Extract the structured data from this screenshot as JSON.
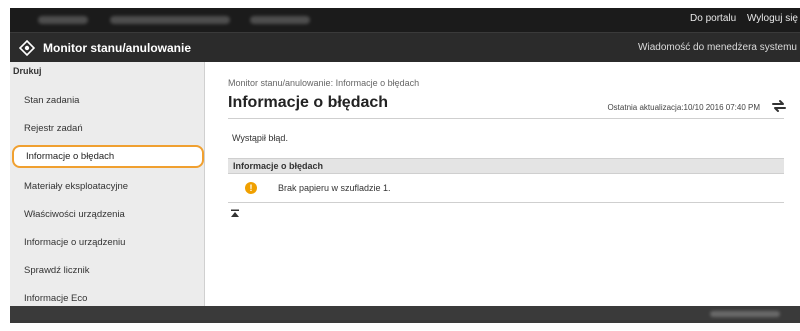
{
  "topbar": {
    "portal_link": "Do portalu",
    "logout_link": "Wyloguj się"
  },
  "header": {
    "app_title": "Monitor stanu/anulowanie",
    "admin_message": "Wiadomość do menedżera systemu"
  },
  "sidebar": {
    "section": "Drukuj",
    "items": [
      {
        "label": "Stan zadania"
      },
      {
        "label": "Rejestr zadań"
      },
      {
        "label": "Informacje o błędach"
      },
      {
        "label": "Materiały eksploatacyjne"
      },
      {
        "label": "Właściwości urządzenia"
      },
      {
        "label": "Informacje o urządzeniu"
      },
      {
        "label": "Sprawdź licznik"
      },
      {
        "label": "Informacje Eco"
      }
    ],
    "active_index": 2
  },
  "main": {
    "breadcrumb": "Monitor stanu/anulowanie: Informacje o błędach",
    "title": "Informacje o błędach",
    "last_update": "Ostatnia aktualizacja:10/10 2016 07:40 PM",
    "message": "Wystąpił błąd.",
    "section_title": "Informacje o błędach",
    "error_item": "Brak papieru w szufladzie 1."
  },
  "colors": {
    "highlight": "#f0a030",
    "warning": "#f0a000",
    "header_bg": "#2b2b2b"
  },
  "icons": [
    "logo-icon",
    "refresh-icon",
    "warning-icon",
    "back-to-top-icon"
  ]
}
